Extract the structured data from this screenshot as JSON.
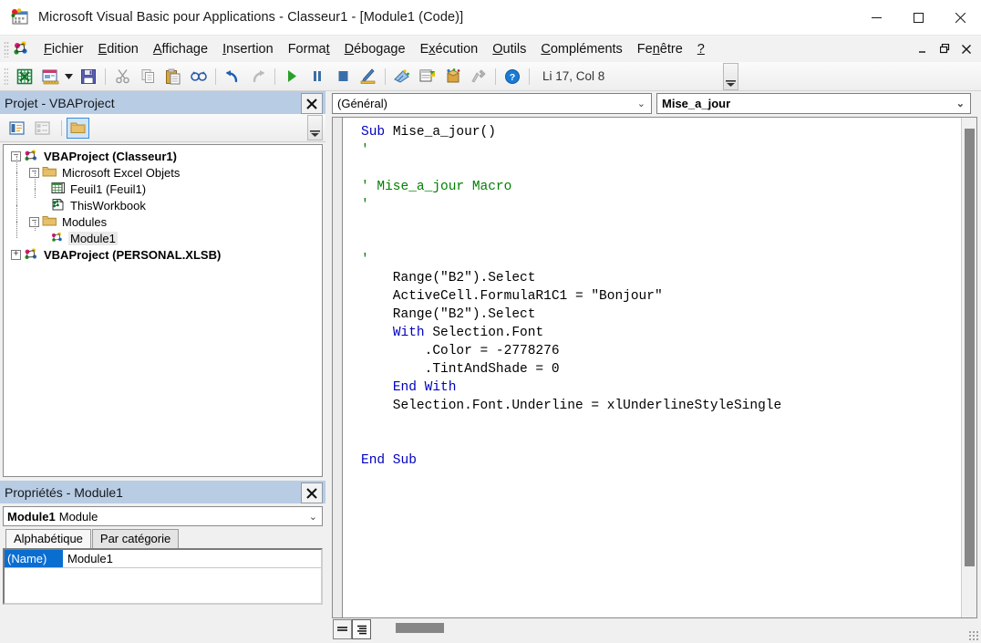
{
  "window": {
    "title": "Microsoft Visual Basic pour Applications - Classeur1 - [Module1 (Code)]",
    "icon": "vba-app-icon",
    "minimize_label": "—",
    "maximize_label": "❐",
    "close_label": "✕"
  },
  "mdi": {
    "minimize_label": "_",
    "restore_label": "❐",
    "close_label": "✕"
  },
  "menu": {
    "logo_icon": "vba-logo-icon",
    "items": [
      {
        "label": "Fichier",
        "accel_index": 0
      },
      {
        "label": "Edition",
        "accel_index": 0
      },
      {
        "label": "Affichage",
        "accel_index": 0
      },
      {
        "label": "Insertion",
        "accel_index": 0
      },
      {
        "label": "Format",
        "accel_index": 5
      },
      {
        "label": "Débogage",
        "accel_index": 0
      },
      {
        "label": "Exécution",
        "accel_index": 1
      },
      {
        "label": "Outils",
        "accel_index": 0
      },
      {
        "label": "Compléments",
        "accel_index": 0
      },
      {
        "label": "Fenêtre",
        "accel_index": 3
      },
      {
        "label": "?",
        "accel_index": 0
      }
    ]
  },
  "toolbar": {
    "buttons": [
      {
        "name": "view-excel-icon"
      },
      {
        "name": "insert-userform-icon"
      },
      {
        "name": "dropdown-caret-icon"
      },
      {
        "name": "save-icon"
      },
      {
        "name": "cut-icon"
      },
      {
        "name": "copy-icon"
      },
      {
        "name": "paste-icon"
      },
      {
        "name": "find-icon"
      },
      {
        "name": "undo-icon"
      },
      {
        "name": "redo-icon"
      },
      {
        "name": "run-icon"
      },
      {
        "name": "break-icon"
      },
      {
        "name": "reset-icon"
      },
      {
        "name": "design-mode-icon"
      },
      {
        "name": "project-explorer-icon"
      },
      {
        "name": "properties-window-icon"
      },
      {
        "name": "object-browser-icon"
      },
      {
        "name": "toolbox-icon"
      },
      {
        "name": "help-icon"
      }
    ],
    "status": "Li 17, Col 8"
  },
  "project_explorer": {
    "title": "Projet - VBAProject",
    "close_label": "✕",
    "toolbar_buttons": [
      {
        "name": "view-code-icon",
        "active": false
      },
      {
        "name": "view-object-icon",
        "active": false
      },
      {
        "name": "toggle-folders-icon",
        "active": true
      }
    ],
    "tree": [
      {
        "label": "VBAProject (Classeur1)",
        "icon": "project-icon",
        "depth": 0,
        "expander": "−",
        "bold": true,
        "selected": false
      },
      {
        "label": "Microsoft Excel Objets",
        "icon": "folder-icon",
        "depth": 1,
        "expander": "−",
        "bold": false,
        "selected": false
      },
      {
        "label": "Feuil1 (Feuil1)",
        "icon": "worksheet-icon",
        "depth": 2,
        "expander": "",
        "bold": false,
        "selected": false
      },
      {
        "label": "ThisWorkbook",
        "icon": "workbook-icon",
        "depth": 2,
        "expander": "",
        "bold": false,
        "selected": false
      },
      {
        "label": "Modules",
        "icon": "folder-icon",
        "depth": 1,
        "expander": "−",
        "bold": false,
        "selected": false
      },
      {
        "label": "Module1",
        "icon": "module-icon",
        "depth": 2,
        "expander": "",
        "bold": false,
        "selected": true
      },
      {
        "label": "VBAProject (PERSONAL.XLSB)",
        "icon": "project-icon",
        "depth": 0,
        "expander": "+",
        "bold": true,
        "selected": false
      }
    ]
  },
  "properties": {
    "title": "Propriétés - Module1",
    "close_label": "✕",
    "object_name": "Module1",
    "object_type": "Module",
    "combo_arrow": "⌄",
    "tabs": [
      {
        "label": "Alphabétique",
        "active": true
      },
      {
        "label": "Par catégorie",
        "active": false
      }
    ],
    "rows": [
      {
        "key": "(Name)",
        "value": "Module1"
      }
    ]
  },
  "code_window": {
    "object_combo": {
      "value": "(Général)",
      "arrow": "⌄"
    },
    "procedure_combo": {
      "value": "Mise_a_jour",
      "arrow": "⌄"
    },
    "code_lines": [
      [
        {
          "t": "Sub ",
          "c": "kw"
        },
        {
          "t": "Mise_a_jour()",
          "c": ""
        }
      ],
      [
        {
          "t": "'",
          "c": "cm"
        }
      ],
      [
        {
          "t": "",
          "c": ""
        }
      ],
      [
        {
          "t": "' Mise_a_jour Macro",
          "c": "cm"
        }
      ],
      [
        {
          "t": "'",
          "c": "cm"
        }
      ],
      [
        {
          "t": "",
          "c": ""
        }
      ],
      [
        {
          "t": "",
          "c": ""
        }
      ],
      [
        {
          "t": "'",
          "c": "cm"
        }
      ],
      [
        {
          "t": "    Range(\"B2\").Select",
          "c": ""
        }
      ],
      [
        {
          "t": "    ActiveCell.FormulaR1C1 = \"Bonjour\"",
          "c": ""
        }
      ],
      [
        {
          "t": "    Range(\"B2\").Select",
          "c": ""
        }
      ],
      [
        {
          "t": "    ",
          "c": ""
        },
        {
          "t": "With ",
          "c": "kw"
        },
        {
          "t": "Selection.Font",
          "c": ""
        }
      ],
      [
        {
          "t": "        .Color = -2778276",
          "c": ""
        }
      ],
      [
        {
          "t": "        .TintAndShade = 0",
          "c": ""
        }
      ],
      [
        {
          "t": "    ",
          "c": ""
        },
        {
          "t": "End With",
          "c": "kw"
        }
      ],
      [
        {
          "t": "    Selection.Font.Underline = xlUnderlineStyleSingle",
          "c": ""
        }
      ],
      [
        {
          "t": "",
          "c": ""
        }
      ],
      [
        {
          "t": "",
          "c": ""
        }
      ],
      [
        {
          "t": "End Sub",
          "c": "kw"
        }
      ]
    ],
    "view_buttons": [
      {
        "name": "procedure-view-button",
        "active": false
      },
      {
        "name": "full-module-view-button",
        "active": true
      }
    ]
  }
}
